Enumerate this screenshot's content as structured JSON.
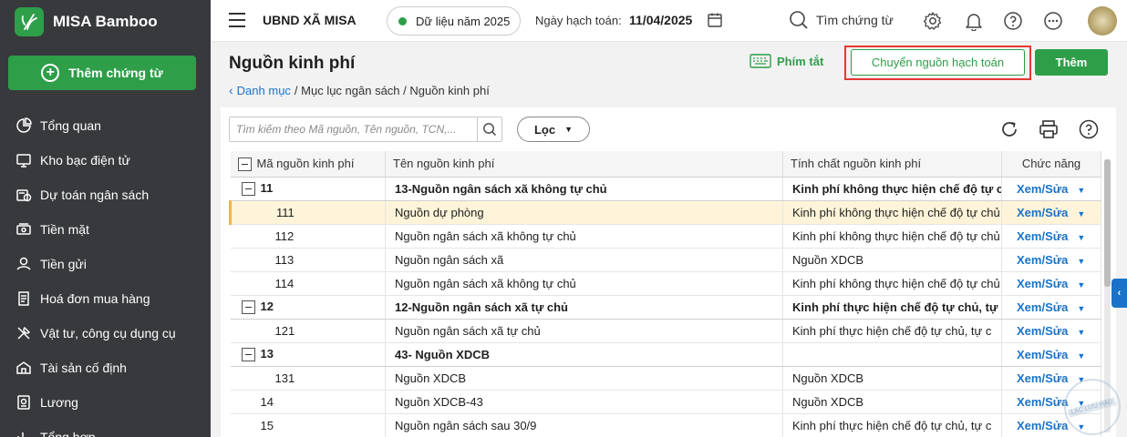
{
  "app": {
    "brand": "MISA Bamboo",
    "add_voucher_label": "Thêm chứng từ"
  },
  "sidebar": {
    "items": [
      {
        "label": "Tổng quan",
        "icon": "pie-chart-icon"
      },
      {
        "label": "Kho bạc điện tử",
        "icon": "monitor-icon"
      },
      {
        "label": "Dự toán ngân sách",
        "icon": "budget-icon"
      },
      {
        "label": "Tiền mặt",
        "icon": "cash-icon"
      },
      {
        "label": "Tiền gửi",
        "icon": "deposit-icon"
      },
      {
        "label": "Hoá đơn mua hàng",
        "icon": "invoice-icon"
      },
      {
        "label": "Vật tư, công cụ dụng cụ",
        "icon": "tools-icon"
      },
      {
        "label": "Tài sản cố định",
        "icon": "asset-icon"
      },
      {
        "label": "Lương",
        "icon": "salary-icon"
      },
      {
        "label": "Tổng hợp",
        "icon": "summary-icon"
      }
    ]
  },
  "header": {
    "org_name": "UBND XÃ MISA",
    "year_label": "Dữ liệu năm 2025",
    "date_label": "Ngày hạch toán:",
    "date_value": "11/04/2025",
    "search_label": "Tìm chứng từ"
  },
  "page": {
    "title": "Nguồn kinh phí",
    "breadcrumb_link": "Danh mục",
    "breadcrumb_rest": "/ Mục lục ngân sách / Nguồn kinh phí",
    "shortcut_label": "Phím tắt",
    "transfer_label": "Chuyển nguồn hạch toán",
    "add_label": "Thêm"
  },
  "toolbar": {
    "search_placeholder": "Tìm kiếm theo Mã nguồn, Tên nguồn, TCN,...",
    "filter_label": "Lọc"
  },
  "table": {
    "columns": [
      "Mã nguồn kinh phí",
      "Tên nguồn kinh phí",
      "Tính chất nguồn kinh phí",
      "Chức năng"
    ],
    "action_label": "Xem/Sửa",
    "rows": [
      {
        "code": "11",
        "name": "13-Nguồn ngân sách xã không tự chủ",
        "nature": "Kinh phí không thực hiện chế độ tự chủ",
        "type": "group"
      },
      {
        "code": "111",
        "name": "Nguồn dự phòng",
        "nature": "Kinh phí không thực hiện chế độ tự chủ",
        "type": "child",
        "selected": true
      },
      {
        "code": "112",
        "name": "Nguồn ngân sách xã không tự chủ",
        "nature": "Kinh phí không thực hiện chế độ tự chủ",
        "type": "child"
      },
      {
        "code": "113",
        "name": "Nguồn ngân sách xã",
        "nature": "Nguồn XDCB",
        "type": "child"
      },
      {
        "code": "114",
        "name": "Nguồn ngân sách xã không tự chủ",
        "nature": "Kinh phí không thực hiện chế độ tự chủ",
        "type": "child"
      },
      {
        "code": "12",
        "name": "12-Nguồn ngân sách xã tự chủ",
        "nature": "Kinh phí thực hiện chế độ tự chủ, tự",
        "type": "group"
      },
      {
        "code": "121",
        "name": "Nguồn ngân sách xã tự chủ",
        "nature": "Kinh phí thực hiện chế độ tự chủ, tự c",
        "type": "child"
      },
      {
        "code": "13",
        "name": "43- Nguồn XDCB",
        "nature": "",
        "type": "group"
      },
      {
        "code": "131",
        "name": "Nguồn XDCB",
        "nature": "Nguồn XDCB",
        "type": "child"
      },
      {
        "code": "14",
        "name": "Nguồn XDCB-43",
        "nature": "Nguồn XDCB",
        "type": "plain"
      },
      {
        "code": "15",
        "name": "Nguồn ngân sách sau 30/9",
        "nature": "Kinh phí thực hiện chế độ tự chủ, tự c",
        "type": "plain"
      }
    ]
  },
  "colors": {
    "brand_green": "#2e9e49",
    "sidebar_bg": "#38393d",
    "link_blue": "#1a73c8",
    "highlight_red": "#e53935",
    "selected_row": "#fff4d9"
  }
}
